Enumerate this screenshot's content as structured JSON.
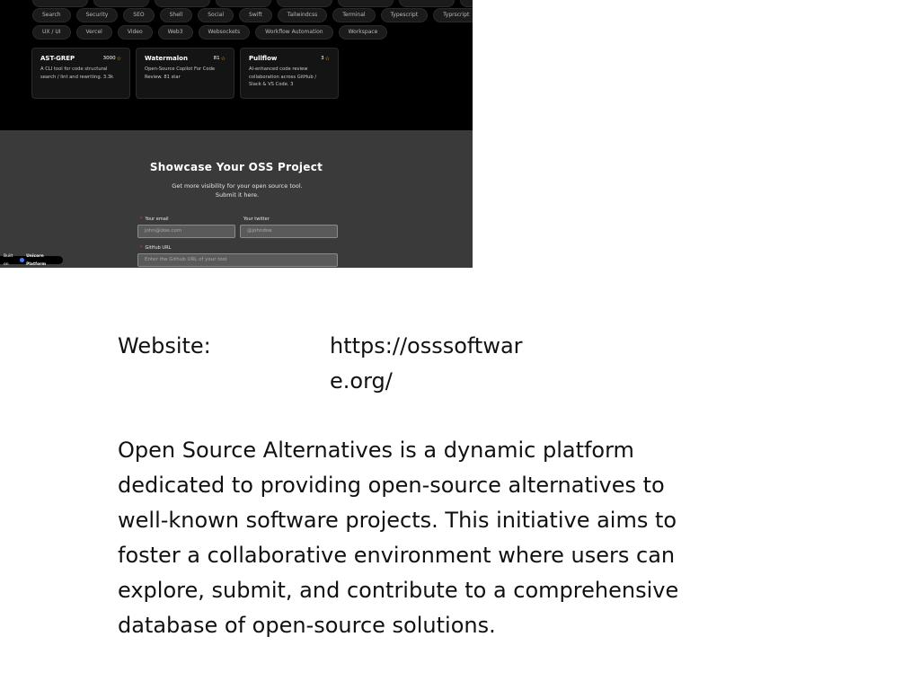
{
  "screenshot": {
    "tag_rows": [
      [
        "",
        "",
        "",
        "",
        "",
        "",
        "",
        ""
      ],
      [
        "Search",
        "Security",
        "SEO",
        "Shell",
        "Social",
        "Swift",
        "Tailwindcss",
        "Terminal",
        "Typescript",
        "Typrscript"
      ],
      [
        "UX / UI",
        "Vercel",
        "Video",
        "Web3",
        "Websockets",
        "Workflow Automation",
        "Workspace"
      ]
    ],
    "cards": [
      {
        "name": "AST-GREP",
        "stars": "3000",
        "description": "A CLI tool for code structural search / lint and rewriting. 3.3k"
      },
      {
        "name": "Watermalon",
        "stars": "81",
        "description": "Open-Source Copilot For Code Review. 81 star"
      },
      {
        "name": "Pullflow",
        "stars": "3",
        "description": "AI-enhanced code review collaboration across GitHub / Slack & VS Code. 3"
      }
    ],
    "showcase": {
      "title": "Showcase Your OSS Project",
      "subtitle": "Get more visibility for your open source tool. Submit it here.",
      "email_label": "Your email",
      "email_placeholder": "john@doe.com",
      "twitter_label": "Your twitter",
      "twitter_placeholder": "@johndoe",
      "github_label": "GitHub URL",
      "github_placeholder": "Enter the Github URL of your tool",
      "required_mark": "*"
    },
    "built_on": {
      "prefix": "Built on",
      "platform": "Unicorn Platform"
    }
  },
  "info": {
    "website_label": "Website:",
    "website_value": "https://osssoftware.org/",
    "description": "Open Source Alternatives is a dynamic platform dedicated to providing open-source alternatives to well-known software projects. This initiative aims to foster a collaborative environment where users can explore, submit, and contribute to a comprehensive database of open-source solutions."
  }
}
